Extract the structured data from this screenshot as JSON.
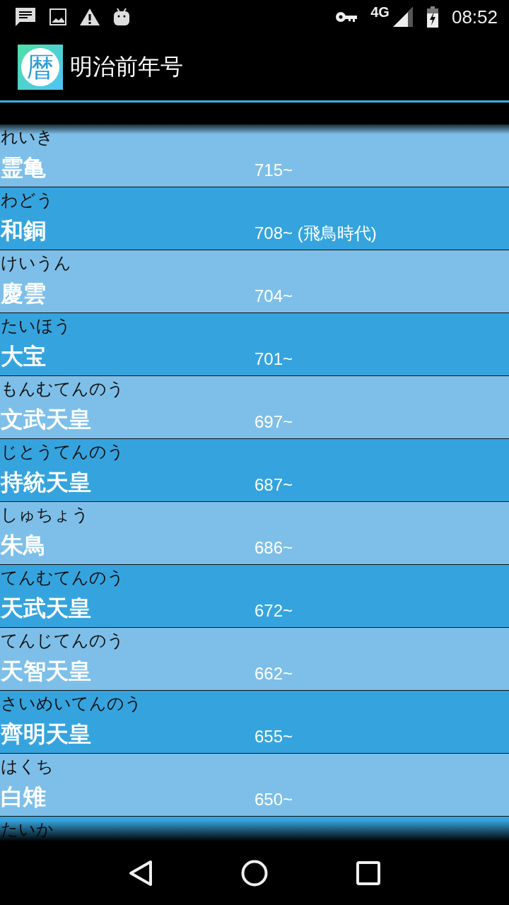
{
  "status_bar": {
    "network": "4G",
    "time": "08:52"
  },
  "app_bar": {
    "icon_glyph": "暦",
    "title": "明治前年号"
  },
  "eras": [
    {
      "reading": "れいき",
      "name": "霊亀",
      "year": "715~"
    },
    {
      "reading": "わどう",
      "name": "和銅",
      "year": "708~ (飛鳥時代)"
    },
    {
      "reading": "けいうん",
      "name": "慶雲",
      "year": "704~"
    },
    {
      "reading": "たいほう",
      "name": "大宝",
      "year": "701~"
    },
    {
      "reading": "もんむてんのう",
      "name": "文武天皇",
      "year": "697~"
    },
    {
      "reading": "じとうてんのう",
      "name": "持統天皇",
      "year": "687~"
    },
    {
      "reading": "しゅちょう",
      "name": "朱鳥",
      "year": "686~"
    },
    {
      "reading": "てんむてんのう",
      "name": "天武天皇",
      "year": "672~"
    },
    {
      "reading": "てんじてんのう",
      "name": "天智天皇",
      "year": "662~"
    },
    {
      "reading": "さいめいてんのう",
      "name": "齊明天皇",
      "year": "655~"
    },
    {
      "reading": "はくち",
      "name": "白雉",
      "year": "650~"
    },
    {
      "reading": "たいか"
    }
  ]
}
